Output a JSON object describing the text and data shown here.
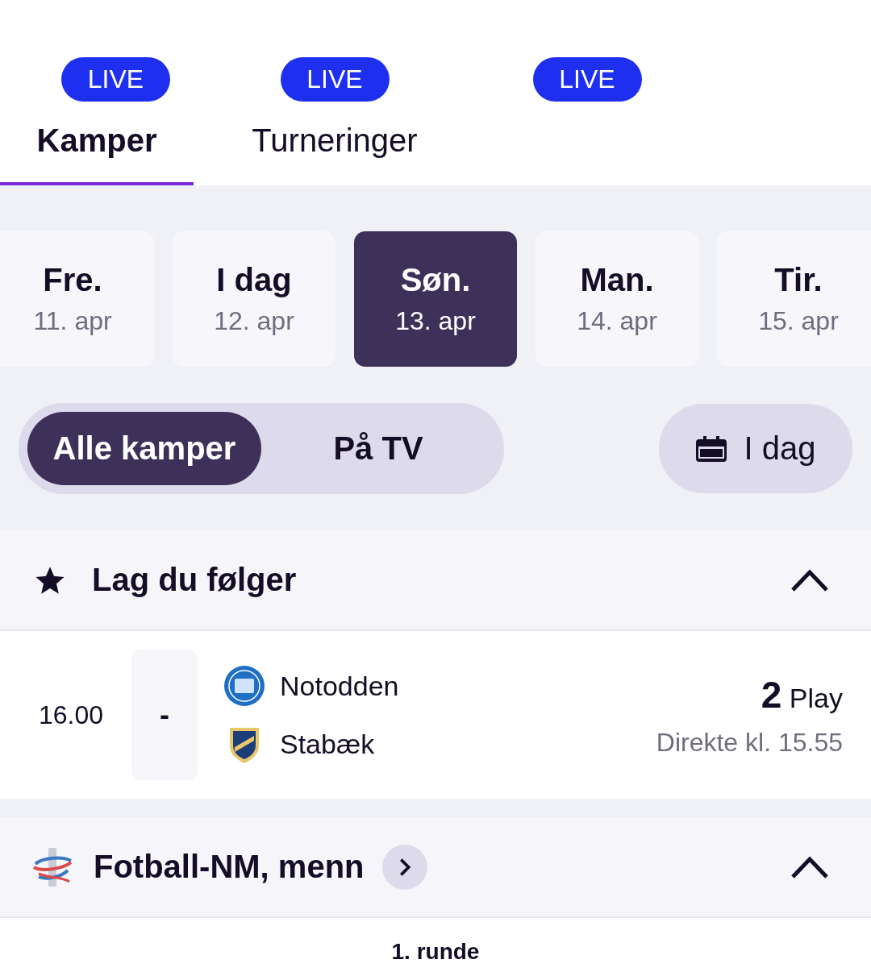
{
  "tabs": [
    {
      "label": "Kamper",
      "badge": "LIVE",
      "selected": true
    },
    {
      "label": "Turneringer",
      "badge": "LIVE",
      "selected": false
    },
    {
      "badge": "LIVE",
      "selected": false
    }
  ],
  "days": [
    {
      "day": "Fre.",
      "date": "11. apr",
      "selected": false
    },
    {
      "day": "I dag",
      "date": "12. apr",
      "selected": false
    },
    {
      "day": "Søn.",
      "date": "13. apr",
      "selected": true
    },
    {
      "day": "Man.",
      "date": "14. apr",
      "selected": false
    },
    {
      "day": "Tir.",
      "date": "15. apr",
      "selected": false
    }
  ],
  "filters": [
    {
      "label": "Alle kamper",
      "selected": true
    },
    {
      "label": "På TV",
      "selected": false
    }
  ],
  "date_button": "I dag",
  "sections": [
    {
      "kind": "followed",
      "title": "Lag du følger",
      "expanded": true,
      "matches": [
        {
          "time": "16.00",
          "score": "-",
          "home": "Notodden",
          "away": "Stabæk",
          "channel": "**2** Play",
          "broadcast": "Direkte kl. 15.55"
        }
      ]
    },
    {
      "kind": "tournament",
      "title": "Fotball-NM, menn",
      "expanded": true,
      "round": "1. runde"
    }
  ]
}
